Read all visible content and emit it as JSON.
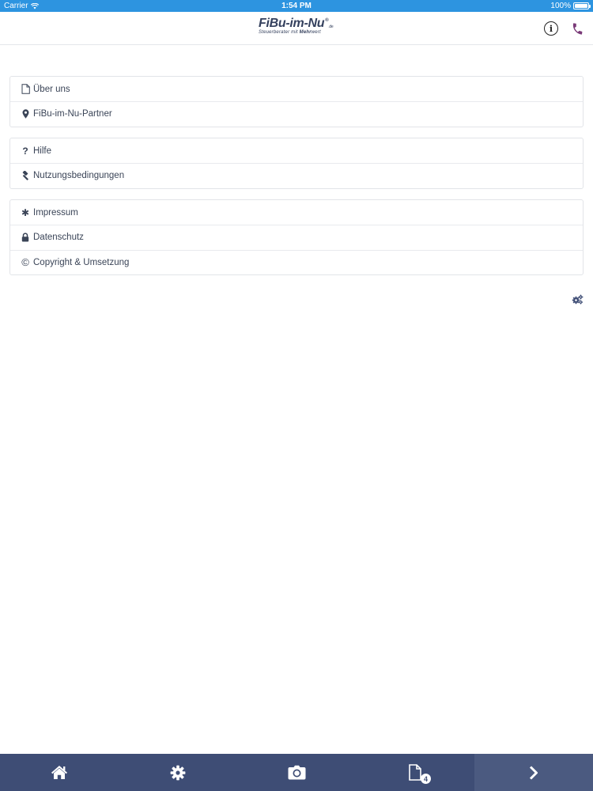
{
  "status_bar": {
    "carrier": "Carrier",
    "time": "1:54 PM",
    "battery": "100%"
  },
  "header": {
    "logo_main": "FiBu-im-Nu",
    "logo_reg": "®",
    "logo_tld": ".de",
    "logo_tagline_prefix": "Steuerberater mit ",
    "logo_tagline_bold": "Mehr",
    "logo_tagline_suffix": "wert",
    "info_glyph": "i",
    "icons": {
      "info": "info-circle-icon",
      "phone": "phone-icon"
    },
    "phone_color": "#7a3a78"
  },
  "menu_groups": [
    {
      "items": [
        {
          "label": "Über uns",
          "icon": "document-icon"
        },
        {
          "label": "FiBu-im-Nu-Partner",
          "icon": "map-marker-icon"
        }
      ]
    },
    {
      "items": [
        {
          "label": "Hilfe",
          "icon": "question-icon",
          "glyph": "?"
        },
        {
          "label": "Nutzungsbedingungen",
          "icon": "gavel-icon"
        }
      ]
    },
    {
      "items": [
        {
          "label": "Impressum",
          "icon": "asterisk-icon",
          "glyph": "✱"
        },
        {
          "label": "Datenschutz",
          "icon": "lock-icon"
        },
        {
          "label": "Copyright & Umsetzung",
          "icon": "copyright-icon",
          "glyph": "©"
        }
      ]
    }
  ],
  "settings_icon": "cogs-icon",
  "tabbar": {
    "background": "#3e4d75",
    "tabs": [
      {
        "icon": "home-icon"
      },
      {
        "icon": "gear-icon"
      },
      {
        "icon": "camera-icon"
      },
      {
        "icon": "document-icon",
        "badge": "4"
      },
      {
        "icon": "chevron-right-icon"
      }
    ]
  }
}
